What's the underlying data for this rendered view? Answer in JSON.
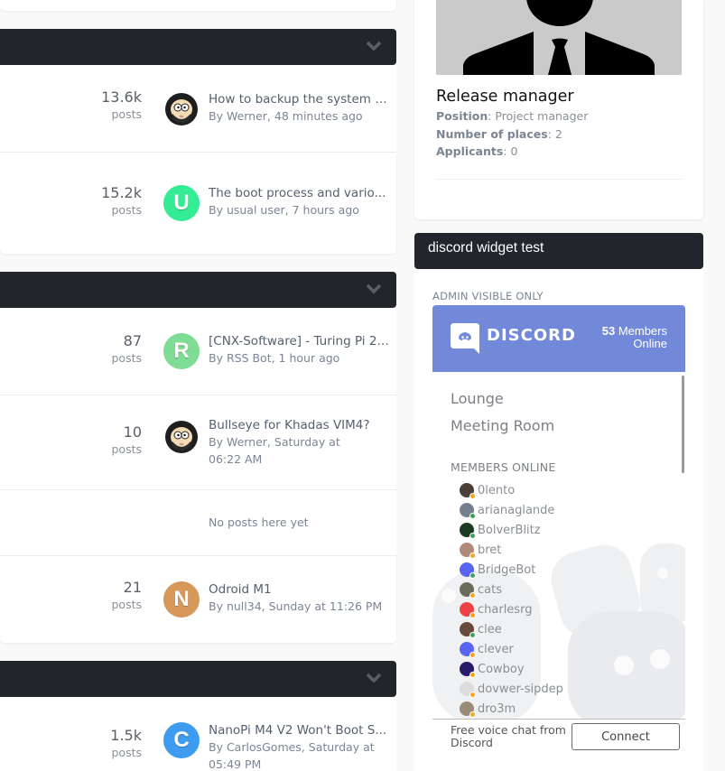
{
  "forum": {
    "categories": [
      {
        "rows": [
          {
            "count": "13.6k",
            "count_label": "posts",
            "avatar": {
              "type": "image",
              "letter": "",
              "color": ""
            },
            "title": "How to backup the system i...",
            "byline": "By Werner, 48 minutes ago"
          },
          {
            "count": "15.2k",
            "count_label": "posts",
            "avatar": {
              "type": "letter",
              "letter": "U",
              "color": "#33ec94"
            },
            "title": "The boot process and vario...",
            "byline": "By usual user, 7 hours ago"
          }
        ]
      },
      {
        "rows": [
          {
            "count": "87",
            "count_label": "posts",
            "avatar": {
              "type": "letter",
              "letter": "R",
              "color": "#7fdc94"
            },
            "title": "[CNX-Software] - Turing Pi 2 ...",
            "byline": "By RSS Bot, 1 hour ago"
          },
          {
            "count": "10",
            "count_label": "posts",
            "avatar": {
              "type": "image",
              "letter": "",
              "color": ""
            },
            "title": "Bullseye for Khadas VIM4?",
            "byline": "By Werner, Saturday at 06:22 AM"
          },
          {
            "empty_text": "No posts here yet"
          },
          {
            "count": "21",
            "count_label": "posts",
            "avatar": {
              "type": "letter",
              "letter": "N",
              "color": "#d7995a"
            },
            "title": "Odroid M1",
            "byline": "By null34, Sunday at 11:26 PM"
          }
        ]
      },
      {
        "rows": [
          {
            "count": "1.5k",
            "count_label": "posts",
            "avatar": {
              "type": "letter",
              "letter": "C",
              "color": "#3d9cf0"
            },
            "title": "NanoPi M4 V2 Won't Boot S...",
            "byline": "By CarlosGomes, Saturday at 05:49 PM"
          }
        ]
      }
    ]
  },
  "job": {
    "title": "Release manager",
    "position_label": "Position",
    "position_value": "Project manager",
    "places_label": "Number of places",
    "places_value": "2",
    "applicants_label": "Applicants",
    "applicants_value": "0"
  },
  "discord_widget": {
    "header": "discord widget test",
    "admin_label": "ADMIN VISIBLE ONLY",
    "brand": "DISCORD",
    "members_count": "53",
    "members_label_1": "Members",
    "members_label_2": "Online",
    "channels": [
      "Lounge",
      "Meeting Room"
    ],
    "members_title": "MEMBERS ONLINE",
    "members": [
      {
        "name": "0lento",
        "avatar_color": "#4a4038",
        "status": "idle"
      },
      {
        "name": "arianaglande",
        "avatar_color": "#747f8d",
        "status": "online"
      },
      {
        "name": "BolverBlitz",
        "avatar_color": "#1c3a22",
        "status": "online"
      },
      {
        "name": "bret",
        "avatar_color": "#b08a78",
        "status": "idle"
      },
      {
        "name": "BridgeBot",
        "avatar_color": "#5865f2",
        "status": "online"
      },
      {
        "name": "cats",
        "avatar_color": "#6b6b5a",
        "status": "idle"
      },
      {
        "name": "charlesrg",
        "avatar_color": "#ed4245",
        "status": "idle"
      },
      {
        "name": "clee",
        "avatar_color": "#6a4a3a",
        "status": "online"
      },
      {
        "name": "clever",
        "avatar_color": "#5865f2",
        "status": "idle"
      },
      {
        "name": "Cowboy",
        "avatar_color": "#2a1a6a",
        "status": "idle"
      },
      {
        "name": "dovwer-sipdep",
        "avatar_color": "#dcdcdc",
        "status": "idle"
      },
      {
        "name": "dro3m",
        "avatar_color": "#9a8a7a",
        "status": "idle"
      }
    ],
    "status_colors": {
      "online": "#3ba55d",
      "idle": "#faa61a"
    },
    "footer_text": "Free voice chat from Discord",
    "connect_label": "Connect"
  },
  "colors": {
    "category_header": "#22252c",
    "discord_brand": "#7289da"
  }
}
